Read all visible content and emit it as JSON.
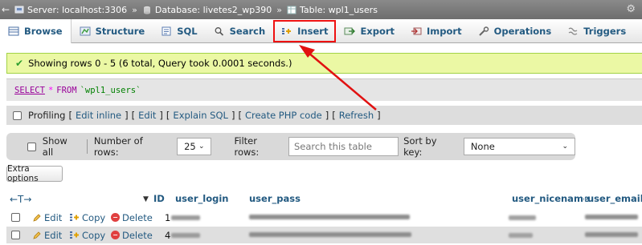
{
  "breadcrumb": {
    "server": "Server: localhost:3306",
    "database": "Database: livetes2_wp390",
    "table": "Table: wpl1_users",
    "separator": "»"
  },
  "tabs": [
    {
      "label": "Browse",
      "icon": "browse-icon"
    },
    {
      "label": "Structure",
      "icon": "structure-icon"
    },
    {
      "label": "SQL",
      "icon": "sql-icon"
    },
    {
      "label": "Search",
      "icon": "search-icon"
    },
    {
      "label": "Insert",
      "icon": "insert-icon"
    },
    {
      "label": "Export",
      "icon": "export-icon"
    },
    {
      "label": "Import",
      "icon": "import-icon"
    },
    {
      "label": "Operations",
      "icon": "operations-icon"
    },
    {
      "label": "Triggers",
      "icon": "triggers-icon"
    }
  ],
  "message": {
    "text": "Showing rows 0 - 5 (6 total, Query took 0.0001 seconds.)"
  },
  "sql": {
    "select": "SELECT",
    "star": "*",
    "from": "FROM",
    "table": "`wpl1_users`"
  },
  "profiling": {
    "label": "Profiling",
    "links": [
      "Edit inline",
      "Edit",
      "Explain SQL",
      "Create PHP code",
      "Refresh"
    ]
  },
  "filter": {
    "show_all": "Show all",
    "number_of_rows_label": "Number of rows:",
    "rows_value": "25",
    "filter_rows_label": "Filter rows:",
    "filter_placeholder": "Search this table",
    "sort_by_label": "Sort by key:",
    "sort_value": "None"
  },
  "extra_options": "Extra options",
  "table": {
    "arrows": "←T→",
    "columns": [
      "ID",
      "user_login",
      "user_pass",
      "user_nicename",
      "user_email"
    ],
    "actions": {
      "edit": "Edit",
      "copy": "Copy",
      "delete": "Delete"
    },
    "rows": [
      {
        "id": "1"
      },
      {
        "id": "4"
      }
    ]
  },
  "colors": {
    "link": "#235a81",
    "success_bg": "#ebf8a4",
    "highlight": "#e11111"
  }
}
